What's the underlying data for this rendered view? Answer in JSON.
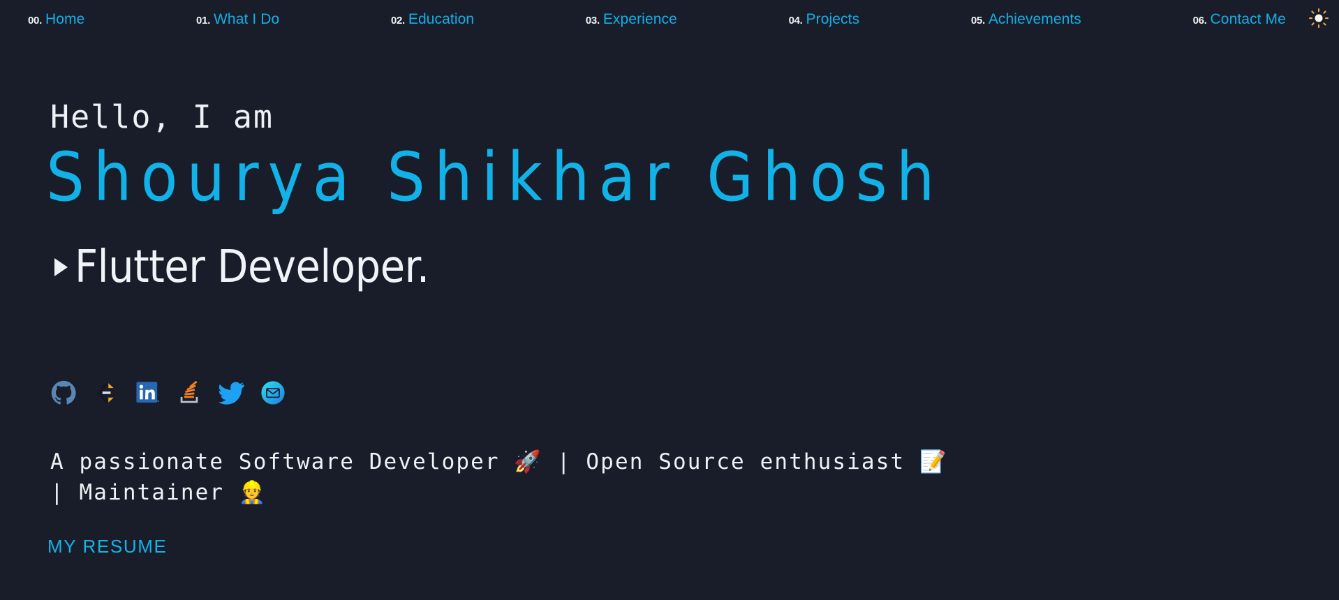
{
  "theme": {
    "background": "#181d29",
    "accent_cyan": "#12b2e8",
    "text_light": "#eef1f5"
  },
  "navbar": {
    "items": [
      {
        "number": "00.",
        "label": "Home",
        "icon": "nav-link-home"
      },
      {
        "number": "01.",
        "label": "What I Do",
        "icon": "nav-link-what-i-do"
      },
      {
        "number": "02.",
        "label": "Education",
        "icon": "nav-link-education"
      },
      {
        "number": "03.",
        "label": "Experience",
        "icon": "nav-link-experience"
      },
      {
        "number": "04.",
        "label": "Projects",
        "icon": "nav-link-projects"
      },
      {
        "number": "05.",
        "label": "Achievements",
        "icon": "nav-link-achievements"
      },
      {
        "number": "06.",
        "label": "Contact Me",
        "icon": "nav-link-contact-me"
      }
    ],
    "theme_toggle": {
      "icon": "sun-icon",
      "label": ""
    }
  },
  "hero": {
    "greeting": "Hello, I am",
    "name": "Shourya Shikhar Ghosh",
    "role_cursor": "▶",
    "role": "Flutter Developer.",
    "description_line_1": "A passionate Software Developer 🚀 | Open Source enthusiast 📝",
    "description_line_2": "| Maintainer 👷",
    "resume_label": "MY RESUME"
  },
  "socials": [
    {
      "name": "github-icon",
      "label": "GitHub",
      "color": "#4a79a8"
    },
    {
      "name": "codeforces-icon",
      "label": "Codeforces",
      "color": "#f5a623"
    },
    {
      "name": "linkedin-icon",
      "label": "LinkedIn",
      "color": "#2867b2"
    },
    {
      "name": "stackoverflow-icon",
      "label": "Stack Overflow",
      "color": "#f48024"
    },
    {
      "name": "twitter-icon",
      "label": "Twitter",
      "color": "#1da1f2"
    },
    {
      "name": "email-icon",
      "label": "Email",
      "color": "#1fb6e8"
    }
  ]
}
